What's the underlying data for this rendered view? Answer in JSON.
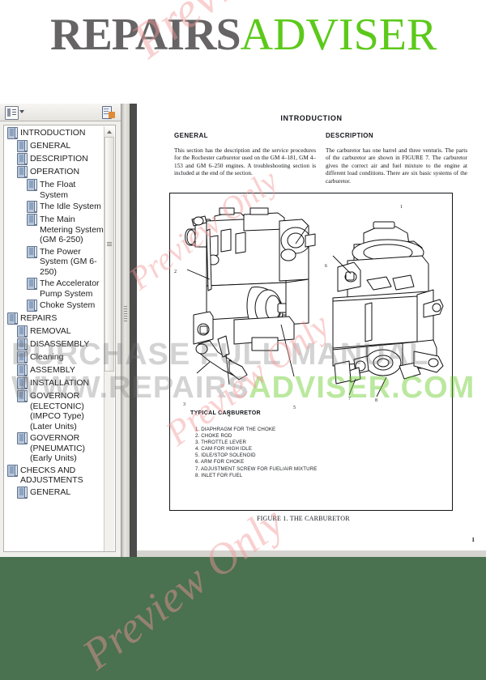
{
  "brand": {
    "name_part1": "REPAIRS",
    "name_part2": "ADVISER",
    "color_gray": "#666464",
    "color_green": "#5cc91a"
  },
  "sidebar": {
    "toolbar": {
      "bookmark_options_icon": "bookmark-list-icon",
      "caret_icon": "chevron-down-icon",
      "export_icon": "export-page-icon"
    },
    "bookmarks": [
      {
        "label": "INTRODUCTION",
        "level": 0,
        "expandable": true
      },
      {
        "label": "GENERAL",
        "level": 1,
        "expandable": false
      },
      {
        "label": "DESCRIPTION",
        "level": 1,
        "expandable": false
      },
      {
        "label": "OPERATION",
        "level": 1,
        "expandable": true
      },
      {
        "label": "The Float System",
        "level": 2,
        "expandable": false
      },
      {
        "label": "The Idle System",
        "level": 2,
        "expandable": false
      },
      {
        "label": "The Main Metering System (GM 6-250)",
        "level": 2,
        "expandable": false
      },
      {
        "label": "The Power System (GM 6-250)",
        "level": 2,
        "expandable": false
      },
      {
        "label": "The Accelerator Pump System",
        "level": 2,
        "expandable": false
      },
      {
        "label": "Choke System",
        "level": 2,
        "expandable": false
      },
      {
        "label": "REPAIRS",
        "level": 0,
        "expandable": true
      },
      {
        "label": "REMOVAL",
        "level": 1,
        "expandable": false
      },
      {
        "label": "DISASSEMBLY",
        "level": 1,
        "expandable": false
      },
      {
        "label": "Cleaning",
        "level": 1,
        "expandable": false
      },
      {
        "label": "ASSEMBLY",
        "level": 1,
        "expandable": false
      },
      {
        "label": "INSTALLATION",
        "level": 1,
        "expandable": false
      },
      {
        "label": "GOVERNOR (ELECTONIC) (IMPCO Type) (Later Units)",
        "level": 1,
        "expandable": false
      },
      {
        "label": "GOVERNOR (PNEUMATIC) (Early Units)",
        "level": 1,
        "expandable": false
      },
      {
        "label": "CHECKS AND ADJUSTMENTS",
        "level": 0,
        "expandable": true
      },
      {
        "label": "GENERAL",
        "level": 1,
        "expandable": false
      }
    ]
  },
  "document": {
    "title": "INTRODUCTION",
    "columns": {
      "general_heading": "GENERAL",
      "general_text": "This section has the description and the service procedures for the Rochester carburetor used on the GM 4–181, GM 4–153 and GM 6–250 engines. A troubleshooting section is included at the end of the section.",
      "description_heading": "DESCRIPTION",
      "description_text": "The carburetor has one barrel and three venturis. The parts of the carburetor are shown in FIGURE 7. The carburetor gives the correct air and fuel mixture to the engine at different load conditions. There are six basic systems of the carburetor."
    },
    "figure": {
      "title": "TYPICAL CARBURETOR",
      "legend": [
        "1. DIAPHRAGM FOR THE CHOKE",
        "2. CHOKE ROD",
        "3. THROTTLE LEVER",
        "4. CAM FOR HIGH IDLE",
        "5. IDLE/STOP SOLENOID",
        "6. ARM FOR CHOKE",
        "7. ADJUSTMENT SCREW FOR FUEL/AIR MIXTURE",
        "8. INLET FOR FUEL"
      ],
      "callouts_left": [
        "1",
        "2",
        "3",
        "4",
        "5"
      ],
      "callouts_right": [
        "6",
        "7",
        "8"
      ],
      "caption": "FIGURE 1. THE CARBURETOR"
    },
    "page_number": "1"
  },
  "watermarks": {
    "purchase": "PURCHASE FULL MANUAL",
    "url_gray": "WWW.REPAIRS",
    "url_green": "ADVISER.COM",
    "preview": "Preview Only"
  }
}
